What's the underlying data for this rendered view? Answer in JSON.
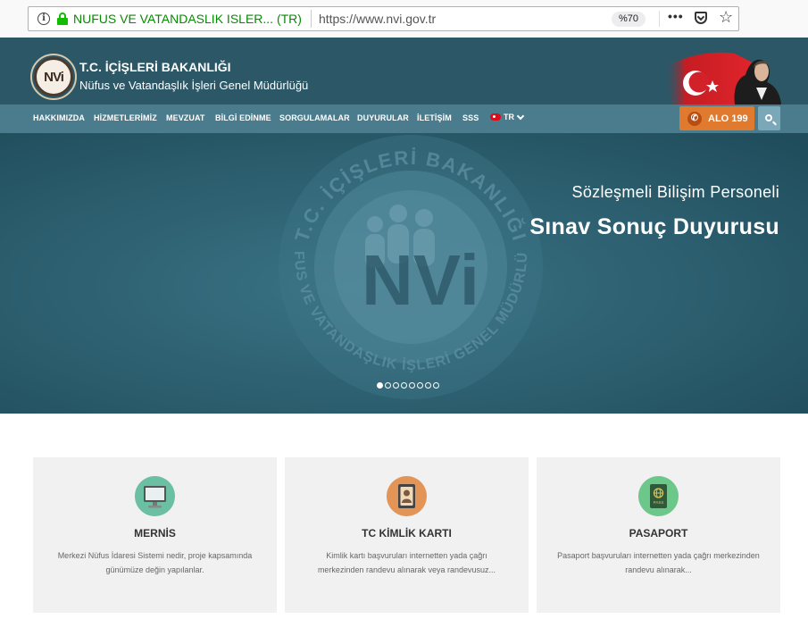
{
  "browser": {
    "site_identity": "NUFUS VE VATANDASLIK ISLER... (TR)",
    "url": "https://www.nvi.gov.tr",
    "zoom": "%70",
    "more_icon": "•••"
  },
  "header": {
    "logo_text": "NVi",
    "ministry": "T.C. İÇİŞLERİ BAKANLIĞI",
    "directorate": "Nüfus ve Vatandaşlık İşleri Genel Müdürlüğü"
  },
  "nav": {
    "items": [
      "HAKKIMIZDA",
      "HİZMETLERİMİZ",
      "MEVZUAT",
      "BİLGİ EDİNME",
      "SORGULAMALAR",
      "DUYURULAR",
      "İLETİŞİM",
      "SSS"
    ],
    "language": "TR",
    "alo_label": "ALO 199"
  },
  "hero": {
    "seal_top_text": "T.C. İÇİŞLERİ BAKANLIĞI",
    "seal_bottom_text": "NÜFUS VE VATANDAŞLIK İŞLERİ GENEL MÜDÜRLÜĞÜ",
    "seal_logo": "NVi",
    "subtitle": "Sözleşmeli Bilişim Personeli",
    "title": "Sınav Sonuç Duyurusu",
    "slide_count": 8,
    "active_slide": 1
  },
  "cards": [
    {
      "title": "MERNİS",
      "desc": "Merkezi Nüfus İdaresi Sistemi nedir, proje kapsamında günümüze değin yapılanlar.",
      "icon": "monitor-icon",
      "color": "#6bc0a3"
    },
    {
      "title": "TC KİMLİK KARTI",
      "desc": "Kimlik kartı başvuruları internetten yada çağrı merkezinden randevu alınarak veya randevusuz...",
      "icon": "id-card-icon",
      "color": "#e29557"
    },
    {
      "title": "PASAPORT",
      "desc": "Pasaport başvuruları internetten yada çağrı merkezinden randevu alınarak...",
      "icon": "passport-icon",
      "color": "#6cc78b"
    }
  ],
  "colors": {
    "header_bg": "#2b5767",
    "nav_bg": "#4a7c8e",
    "alo_bg": "#e07a2e"
  }
}
